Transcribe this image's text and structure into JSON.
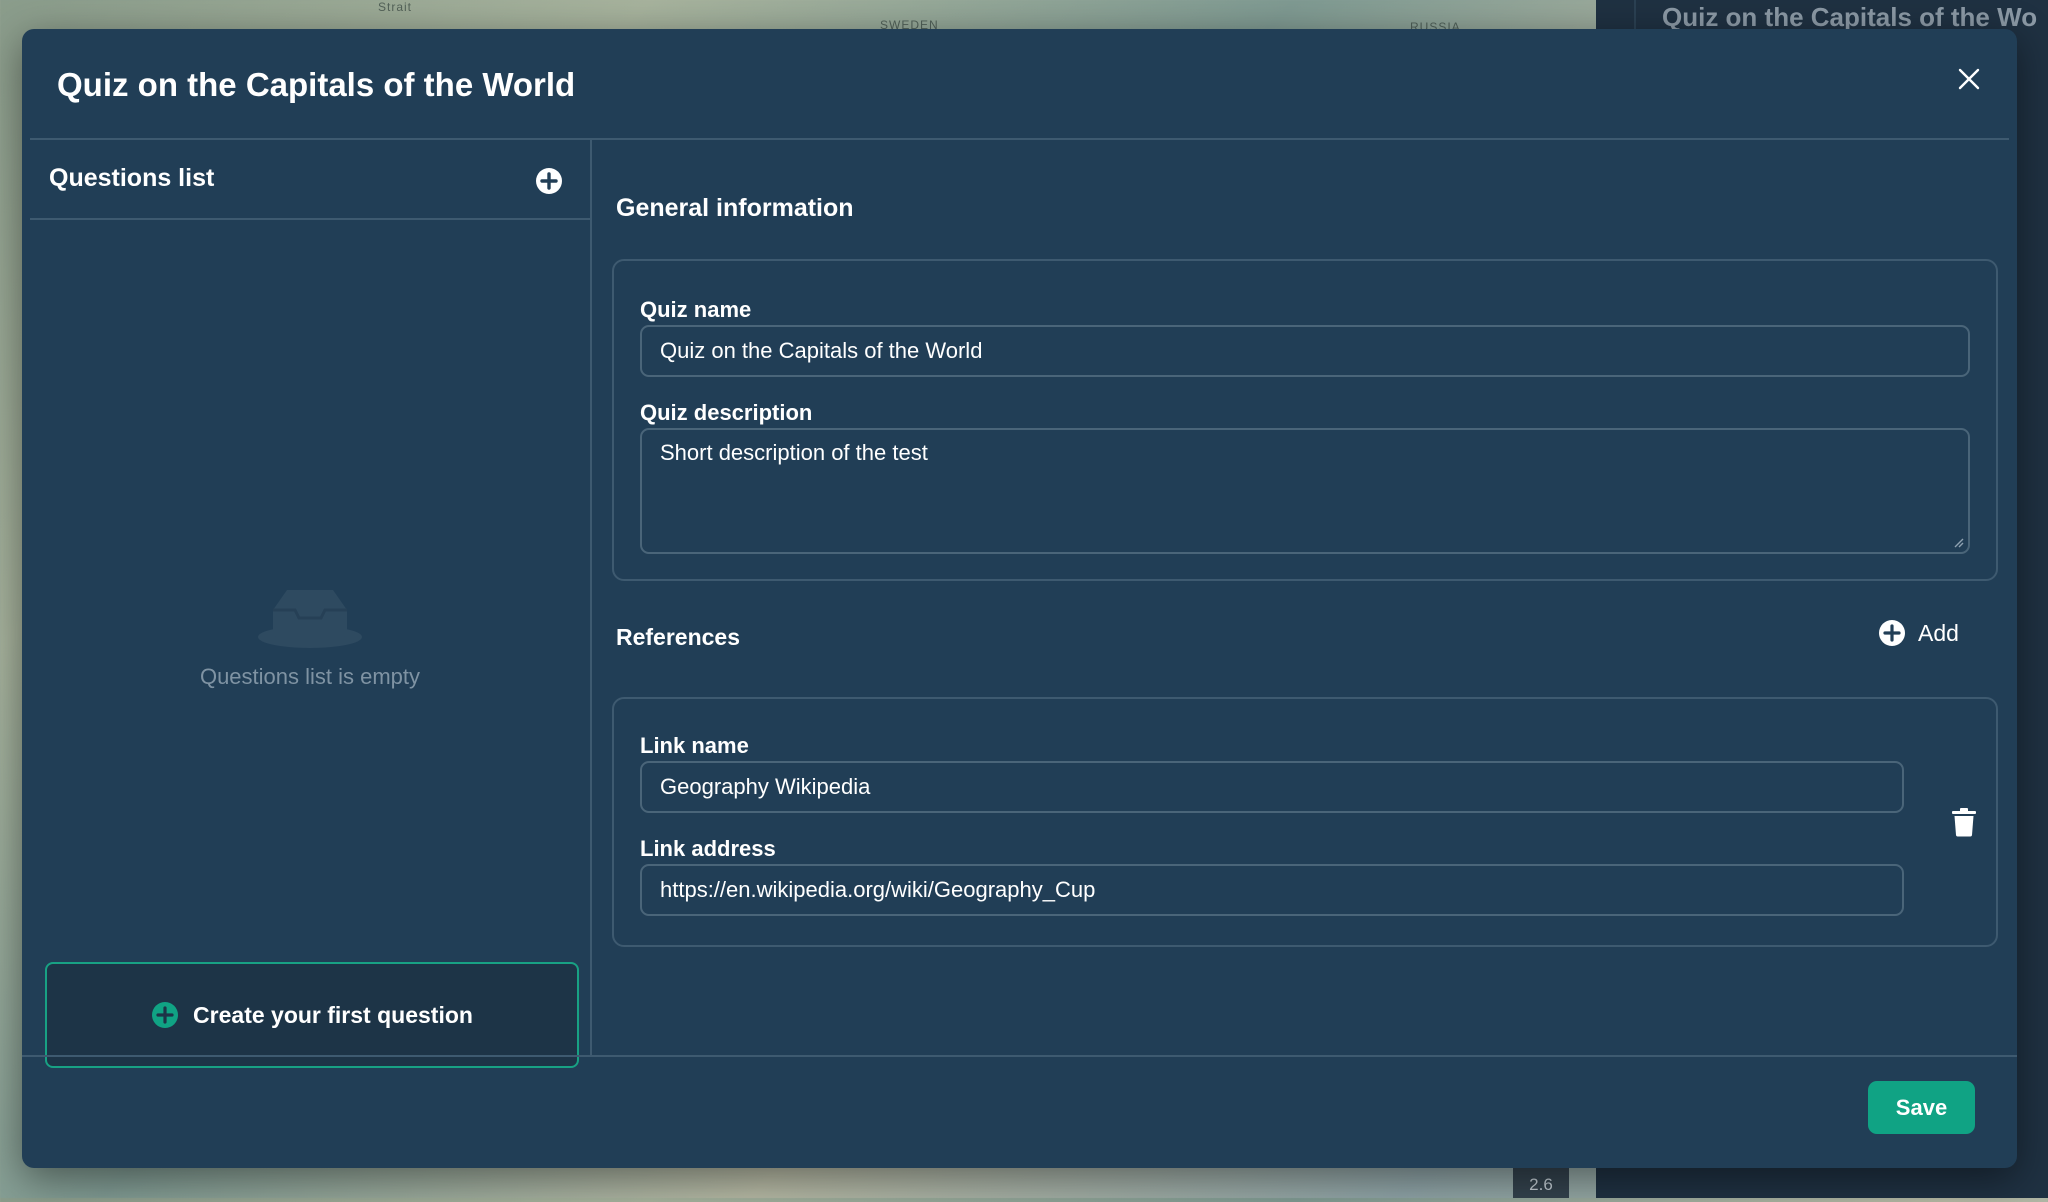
{
  "background": {
    "map_labels": [
      "Strait",
      "SWEDEN",
      "RUSSIA"
    ],
    "side_panel_title": "Quiz on the Capitals of the Wo",
    "zoom_level": "2.6"
  },
  "modal": {
    "title": "Quiz on the Capitals of the World",
    "close_icon": "close-icon"
  },
  "questions": {
    "header": "Questions list",
    "add_icon": "plus-circle-icon",
    "empty_text": "Questions list is empty",
    "create_button": "Create your first question"
  },
  "general": {
    "title": "General information",
    "quiz_name_label": "Quiz name",
    "quiz_name_value": "Quiz on the Capitals of the World",
    "quiz_description_label": "Quiz description",
    "quiz_description_value": "Short description of the test"
  },
  "references": {
    "title": "References",
    "add_label": "Add",
    "items": [
      {
        "link_name_label": "Link name",
        "link_name_value": "Geography Wikipedia",
        "link_address_label": "Link address",
        "link_address_value": "https://en.wikipedia.org/wiki/Geography_Cup"
      }
    ]
  },
  "footer": {
    "save_label": "Save"
  },
  "colors": {
    "modal_bg": "#213e56",
    "accent": "#10a384",
    "border": "#3e5a70"
  }
}
